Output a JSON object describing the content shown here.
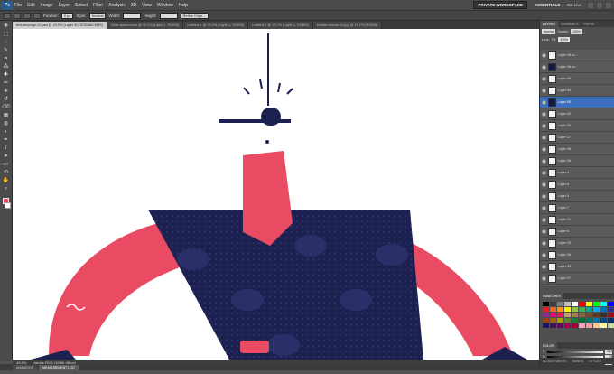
{
  "app": {
    "logo": "Ps",
    "menu": [
      "File",
      "Edit",
      "Image",
      "Layer",
      "Select",
      "Filter",
      "Analysis",
      "3D",
      "View",
      "Window",
      "Help"
    ],
    "workspaces": [
      "PRIVATE WORKSPACE",
      "ESSENTIALS"
    ],
    "cs_live": "CS Live"
  },
  "options_bar": {
    "feather_label": "Feather:",
    "feather_value": "0 px",
    "style_label": "Style:",
    "style_value": "Normal",
    "width_label": "Width:",
    "height_label": "Height:",
    "refine_edge": "Refine Edge..."
  },
  "document_tabs": [
    {
      "label": "text-keepngo-02.psd @ 43,5% (Layer 50, RGB/8#CMYK)",
      "active": true
    },
    {
      "label": "Best opened.psd @ 50,1% (Layer 1, RGB/8)",
      "active": false
    },
    {
      "label": "Untitled-1 @ 33,3% (Layer 1, RGB/8)",
      "active": false
    },
    {
      "label": "Untitled-2 @ 16,7% (Layer 1, RGB/8)",
      "active": false
    },
    {
      "label": "Kotsifa-Mouse-2a.jpg @ 16,7% (RGB/8)",
      "active": false
    }
  ],
  "toolbox": {
    "tools": [
      "move-tool",
      "marquee-tool",
      "lasso-tool",
      "quick-select-tool",
      "crop-tool",
      "eyedropper-tool",
      "healing-tool",
      "brush-tool",
      "stamp-tool",
      "history-brush-tool",
      "eraser-tool",
      "gradient-tool",
      "blur-tool",
      "dodge-tool",
      "pen-tool",
      "type-tool",
      "path-select-tool",
      "shape-tool",
      "3d-rotate-tool",
      "hand-tool",
      "zoom-tool"
    ],
    "glyphs": [
      "✥",
      "⬚",
      "◌",
      "✎",
      "⌗",
      "⁂",
      "✚",
      "✏",
      "⎈",
      "↺",
      "⌫",
      "▦",
      "◍",
      "◐",
      "✒",
      "T",
      "➤",
      "▭",
      "⟲",
      "✋",
      "⌕"
    ],
    "foreground": "#e94b62",
    "background": "#ffffff"
  },
  "status": {
    "zoom": "43,5%",
    "doc_info": "Adobe RGB (1998) (8bpc)"
  },
  "bottom_tabs": [
    "ANIMATION",
    "MEASUREMENT LOG"
  ],
  "panels": {
    "layer_tabs": [
      "LAYERS",
      "CHANNELS",
      "PATHS"
    ],
    "blend_mode": "Normal",
    "opacity_label": "Opacity:",
    "opacity_value": "100%",
    "lock_label": "Lock:",
    "fill_label": "Fill:",
    "fill_value": "100%",
    "layers": [
      {
        "name": "Layer 48 co...",
        "thumb": "light",
        "selected": false
      },
      {
        "name": "Layer 48 co...",
        "thumb": "dark",
        "selected": false
      },
      {
        "name": "Layer 45",
        "thumb": "light",
        "selected": false
      },
      {
        "name": "Layer 44",
        "thumb": "light",
        "selected": false
      },
      {
        "name": "Layer 50",
        "thumb": "dark",
        "selected": true
      },
      {
        "name": "Layer 40",
        "thumb": "light",
        "selected": false
      },
      {
        "name": "Layer 39",
        "thumb": "light",
        "selected": false
      },
      {
        "name": "Layer 37",
        "thumb": "light",
        "selected": false
      },
      {
        "name": "Layer 38",
        "thumb": "light",
        "selected": false
      },
      {
        "name": "Layer 36",
        "thumb": "light",
        "selected": false
      },
      {
        "name": "Layer 4",
        "thumb": "light",
        "selected": false
      },
      {
        "name": "Layer 6",
        "thumb": "light",
        "selected": false
      },
      {
        "name": "Layer 5",
        "thumb": "light",
        "selected": false
      },
      {
        "name": "Layer 7",
        "thumb": "light",
        "selected": false
      },
      {
        "name": "Layer 31",
        "thumb": "light",
        "selected": false
      },
      {
        "name": "Layer 8",
        "thumb": "light",
        "selected": false
      },
      {
        "name": "Layer 25",
        "thumb": "light",
        "selected": false
      },
      {
        "name": "Layer 26",
        "thumb": "light",
        "selected": false
      },
      {
        "name": "Layer 33",
        "thumb": "light",
        "selected": false
      },
      {
        "name": "Layer 27",
        "thumb": "light",
        "selected": false
      }
    ],
    "swatches_tab": "SWATCHES",
    "swatch_colors": [
      "#000000",
      "#404040",
      "#808080",
      "#c0c0c0",
      "#ffffff",
      "#ff0000",
      "#ffff00",
      "#00ff00",
      "#00ffff",
      "#0000ff",
      "#ed1c24",
      "#f26522",
      "#f7941d",
      "#fff200",
      "#8dc63f",
      "#39b54a",
      "#00a99d",
      "#00aeef",
      "#0072bc",
      "#2e3192",
      "#92278f",
      "#ec008c",
      "#ed145b",
      "#c69c6d",
      "#a67c52",
      "#8c6239",
      "#754c24",
      "#603913",
      "#362f2d",
      "#9e0b0f",
      "#a0410d",
      "#a36209",
      "#aba000",
      "#598527",
      "#197b30",
      "#007236",
      "#00746b",
      "#0076a3",
      "#004a80",
      "#003471",
      "#1b1464",
      "#440e62",
      "#630460",
      "#9e005d",
      "#9e0039",
      "#f49ac2",
      "#f6989d",
      "#fdc68a",
      "#fff799",
      "#c4df9b"
    ],
    "color_tab": "COLOR",
    "color_sliders": [
      {
        "label": "R",
        "value": "233"
      },
      {
        "label": "G",
        "value": "75"
      },
      {
        "label": "B",
        "value": "98"
      }
    ],
    "adjustments_tabs": [
      "ADJUSTMENTS",
      "MASKS",
      "STYLES"
    ]
  }
}
